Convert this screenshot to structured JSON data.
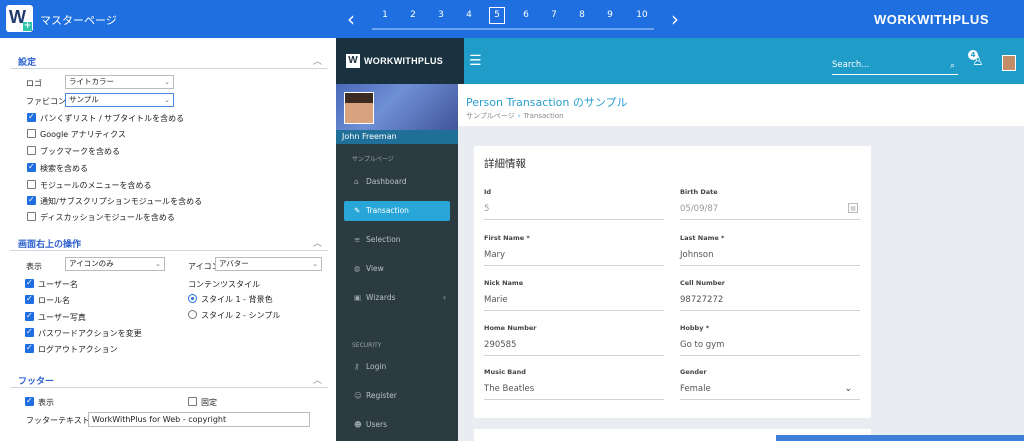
{
  "top": {
    "title": "マスターページ",
    "pages": [
      "1",
      "2",
      "3",
      "4",
      "5",
      "6",
      "7",
      "8",
      "9",
      "10"
    ],
    "active_page": "5",
    "prev": "‹",
    "next": "›",
    "brand": "WORKWITHPLUS"
  },
  "settings": {
    "section1": {
      "title": "設定",
      "logo_label": "ロゴ",
      "logo_value": "ライトカラー",
      "favicon_label": "ファビコン",
      "favicon_value": "サンプル",
      "checks": [
        {
          "label": "パンくずリスト / サブタイトルを含める",
          "checked": true
        },
        {
          "label": "Google アナリティクス",
          "checked": false
        },
        {
          "label": "ブックマークを含める",
          "checked": false
        },
        {
          "label": "検索を含める",
          "checked": true
        },
        {
          "label": "モジュールのメニューを含める",
          "checked": false
        },
        {
          "label": "通知/サブスクリプションモジュールを含める",
          "checked": true
        },
        {
          "label": "ディスカッションモジュールを含める",
          "checked": false
        }
      ]
    },
    "section2": {
      "title": "画面右上の操作",
      "display_label": "表示",
      "display_value": "アイコンのみ",
      "icon_label": "アイコン",
      "icon_value": "アバター",
      "checks": [
        {
          "label": "ユーザー名",
          "checked": true
        },
        {
          "label": "ロール名",
          "checked": true
        },
        {
          "label": "ユーザー写真",
          "checked": true
        },
        {
          "label": "パスワードアクションを変更",
          "checked": true
        },
        {
          "label": "ログアウトアクション",
          "checked": true
        }
      ],
      "content_style_label": "コンテンツスタイル",
      "styles": [
        {
          "label": "スタイル 1 - 背景色",
          "selected": true
        },
        {
          "label": "スタイル 2 - シンプル",
          "selected": false
        }
      ]
    },
    "section3": {
      "title": "フッター",
      "show_label": "表示",
      "show_checked": true,
      "fixed_label": "固定",
      "fixed_checked": false,
      "footer_text_label": "フッターテキスト",
      "footer_text_value": "WorkWithPlus for Web - copyright"
    }
  },
  "preview": {
    "brand": "WORKWITHPLUS",
    "search_placeholder": "Search...",
    "notif_count": "4",
    "user_name": "John Freeman",
    "menu_caption": "サンプルページ",
    "menu": [
      {
        "label": "Dashboard",
        "icon": "home-icon"
      },
      {
        "label": "Transaction",
        "icon": "edit-icon",
        "active": true
      },
      {
        "label": "Selection",
        "icon": "list-icon"
      },
      {
        "label": "View",
        "icon": "globe-icon"
      },
      {
        "label": "Wizards",
        "icon": "briefcase-icon",
        "has_arrow": true
      }
    ],
    "security_caption": "SECURITY",
    "security_menu": [
      {
        "label": "Login",
        "icon": "key-icon"
      },
      {
        "label": "Register",
        "icon": "user-plus-icon"
      },
      {
        "label": "Users",
        "icon": "user-icon"
      }
    ],
    "page_title": "Person Transaction のサンプル",
    "breadcrumb": [
      "サンプルページ",
      "Transaction"
    ],
    "card_title": "詳細情報",
    "fields": {
      "id": {
        "label": "Id",
        "value": "5"
      },
      "birth_date": {
        "label": "Birth Date",
        "value": "05/09/87"
      },
      "first_name": {
        "label": "First Name",
        "value": "Mary"
      },
      "last_name": {
        "label": "Last Name",
        "value": "Johnson"
      },
      "nick_name": {
        "label": "Nick Name",
        "value": "Marie"
      },
      "cell_number": {
        "label": "Cell Number",
        "value": "98727272"
      },
      "home_number": {
        "label": "Home Number",
        "value": "290585"
      },
      "hobby": {
        "label": "Hobby",
        "value": "Go to gym"
      },
      "music_band": {
        "label": "Music Band",
        "value": "The Beatles"
      },
      "gender": {
        "label": "Gender",
        "value": "Female"
      }
    },
    "required_mark": "*"
  },
  "colors": {
    "topbar": "#1f6fe0",
    "app_header": "#1f9cc7",
    "sidebar": "#2c3a42",
    "active_item": "#29a6d8",
    "section_title": "#2a5fcf"
  }
}
